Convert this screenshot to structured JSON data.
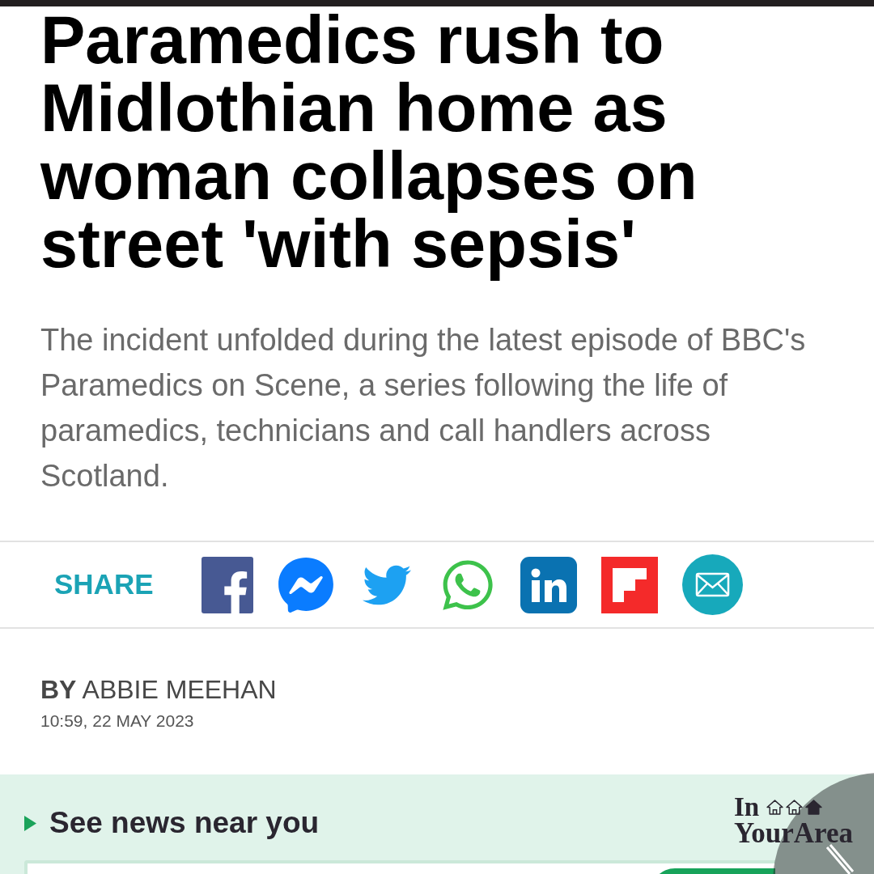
{
  "headline": "Paramedics rush to Midlothian home as woman collapses on street 'with sepsis'",
  "standfirst": "The incident unfolded during the latest episode of BBC's Paramedics on Scene, a series following the life of paramedics, technicians and call handlers across Scotland.",
  "share": {
    "label": "SHARE"
  },
  "byline": {
    "author": "**BY** ABBIE MEEHAN",
    "timestamp": "10:59, 22 MAY 2023"
  },
  "local_news": {
    "heading": "See news near you",
    "logo": {
      "line_1": "In",
      "line_2": "YourArea"
    }
  }
}
